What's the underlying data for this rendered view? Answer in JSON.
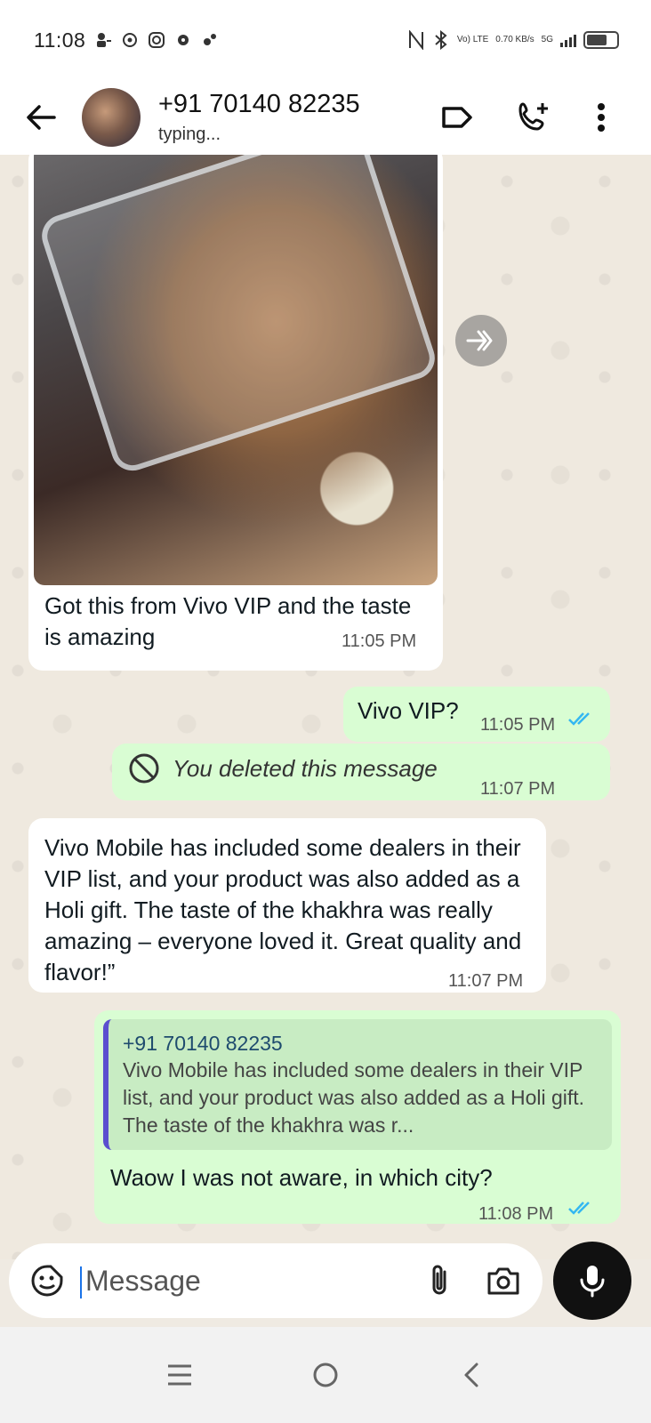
{
  "status_bar": {
    "time": "11:08",
    "network_label_top": "Vo) LTE",
    "speed": "0.70 KB/s",
    "network_type": "5G"
  },
  "header": {
    "contact_name": "+91 70140 82235",
    "status": "typing..."
  },
  "messages": [
    {
      "type": "image",
      "direction": "incoming",
      "caption": "Got this from Vivo VIP and the taste is amazing",
      "time": "11:05 PM"
    },
    {
      "type": "text",
      "direction": "outgoing",
      "text": "Vivo VIP?",
      "time": "11:05 PM",
      "status": "read"
    },
    {
      "type": "deleted",
      "direction": "outgoing",
      "text": "You deleted this message",
      "time": "11:07 PM"
    },
    {
      "type": "text",
      "direction": "incoming",
      "text": "Vivo Mobile has included some dealers in their VIP list, and your product was also added as a Holi gift. The taste of the khakhra was really amazing – everyone loved it. Great quality and flavor!”",
      "time": "11:07 PM"
    },
    {
      "type": "reply",
      "direction": "outgoing",
      "quote_author": "+91 70140 82235",
      "quote_text": "Vivo Mobile has included some dealers in their VIP list, and your product was also added as a Holi gift. The taste of the khakhra was r...",
      "text": "Waow I was not aware, in which city?",
      "time": "11:08 PM",
      "status": "read"
    }
  ],
  "composer": {
    "placeholder": "Message"
  },
  "colors": {
    "incoming_bubble": "#ffffff",
    "outgoing_bubble": "#d9fdd3",
    "read_ticks": "#34b7f1",
    "chat_background": "#efe9df"
  }
}
